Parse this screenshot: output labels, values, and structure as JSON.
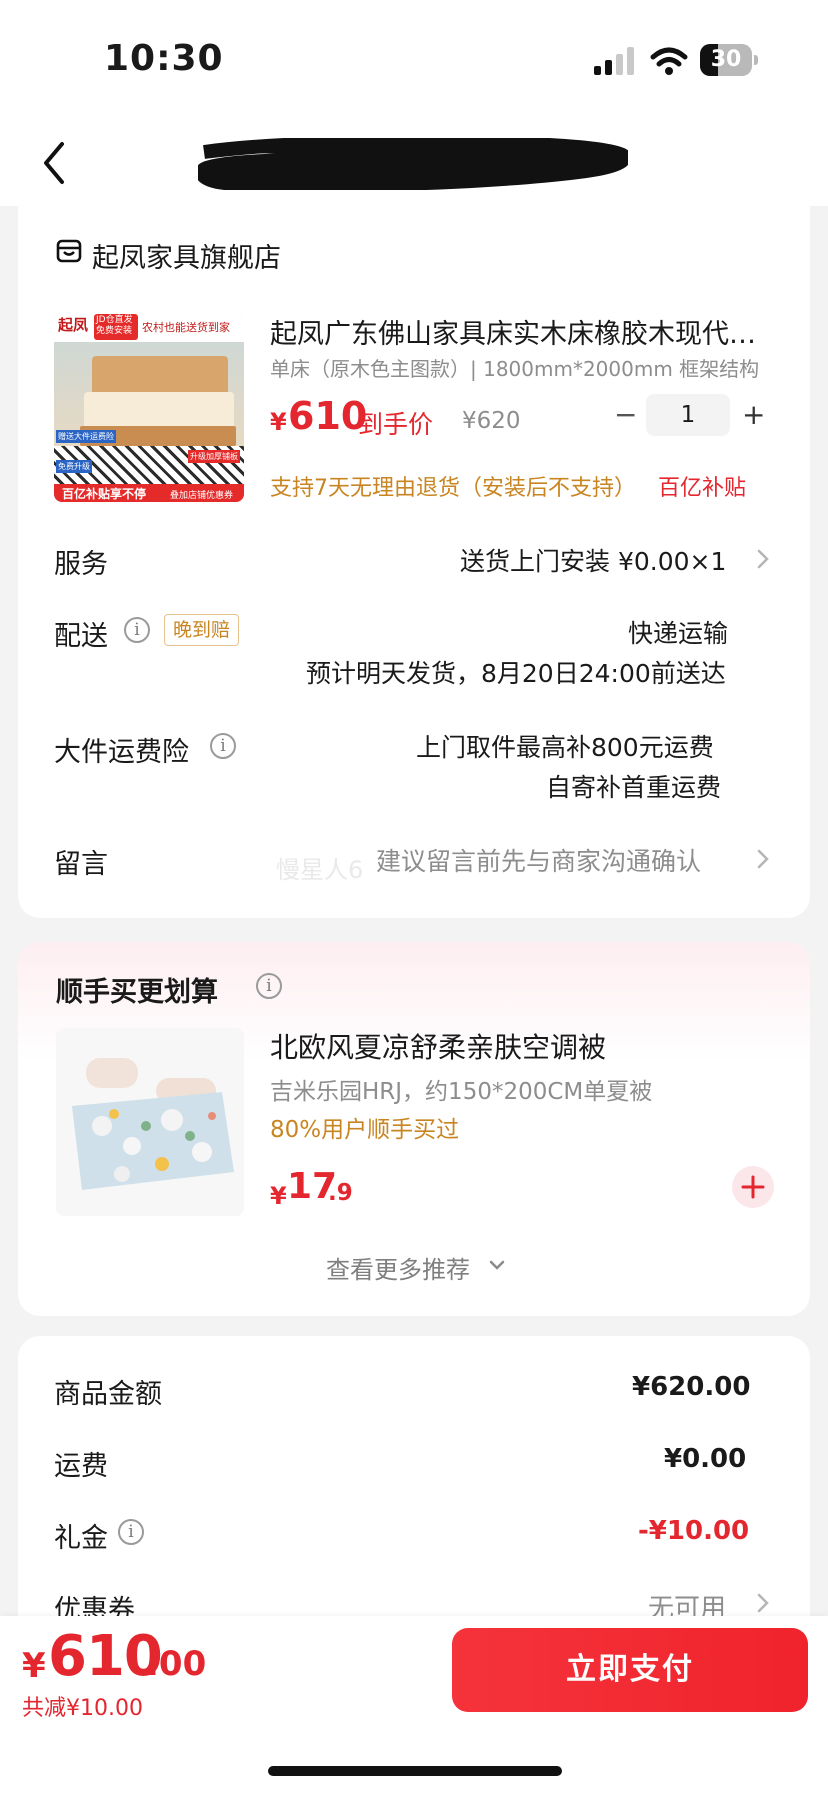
{
  "status_bar": {
    "time": "10:30",
    "battery": "30"
  },
  "shop": {
    "name": "起凤家具旗舰店"
  },
  "product": {
    "title": "起凤广东佛山家具床实木床橡胶木现代…",
    "spec": "单床（原木色主图款）| 1800mm*2000mm  框架结构",
    "price_symbol": "¥",
    "price": "610",
    "price_tag": "到手价",
    "original_price": "¥620",
    "quantity": "1",
    "minus": "−",
    "plus": "+",
    "policy": "支持7天无理由退货（安装后不支持）",
    "subsidy": "百亿补贴",
    "image_texts": {
      "brand": "起凤",
      "badge": "JD仓直发 免费安装",
      "banner": "农村也能送货到家",
      "tag1": "赠送大件运费险",
      "tag2": "免费升级",
      "tag3": "升级加厚铺板",
      "footer": "百亿补贴享不停",
      "footer2": "叠加店铺优惠券"
    }
  },
  "rows": {
    "service_label": "服务",
    "service_value": "送货上门安装  ¥0.00×1",
    "delivery_label": "配送",
    "delivery_badge": "晚到赔",
    "delivery_value1": "快递运输",
    "delivery_value2": "预计明天发货，8月20日24:00前送达",
    "insurance_label": "大件运费险",
    "insurance_value1": "上门取件最高补800元运费",
    "insurance_value2": "自寄补首重运费",
    "message_label": "留言",
    "message_placeholder": "建议留言前先与商家沟通确认",
    "message_ghost": "慢星人6"
  },
  "addon": {
    "title": "顺手买更划算",
    "item_title": "北欧风夏凉舒柔亲肤空调被",
    "item_spec": "吉米乐园HRJ，约150*200CM单夏被",
    "item_social": "80%用户顺手买过",
    "price_symbol": "¥",
    "price_int": "17",
    "price_dec": ".9",
    "more": "查看更多推荐"
  },
  "summary": {
    "goods_label": "商品金额",
    "goods_value": "¥620.00",
    "freight_label": "运费",
    "freight_value": "¥0.00",
    "gift_label": "礼金",
    "gift_value": "-¥10.00",
    "coupon_label": "优惠券",
    "coupon_value": "无可用"
  },
  "footer": {
    "total_symbol": "¥",
    "total_int": "610",
    "total_dec": ".00",
    "saved": "共减¥10.00",
    "pay_button": "立即支付"
  },
  "colors": {
    "accent": "#e4262f",
    "orange": "#c98522",
    "muted": "#8d8d8d"
  }
}
